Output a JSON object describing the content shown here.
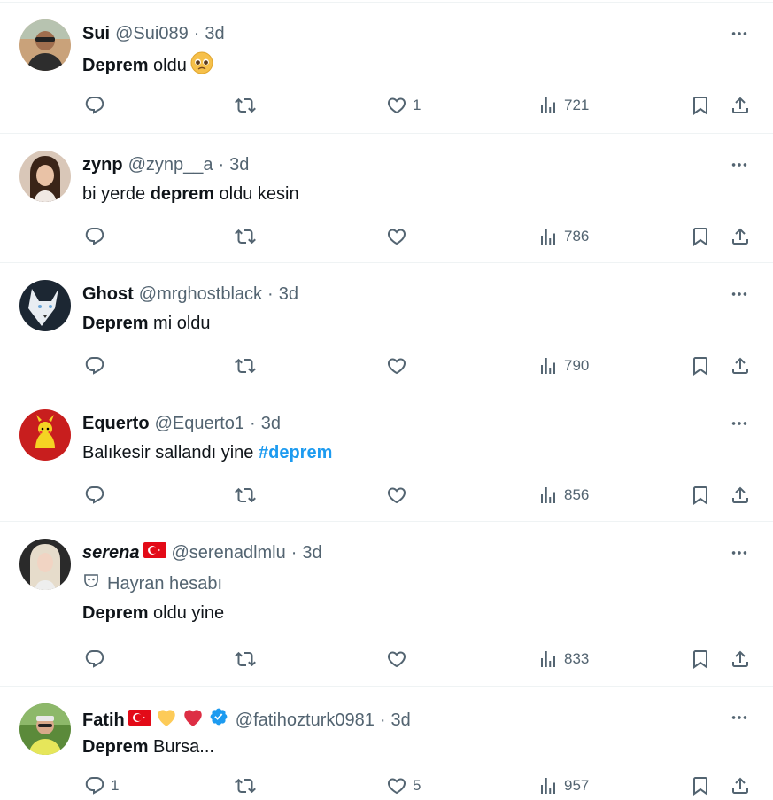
{
  "tweets": [
    {
      "name": "Sui",
      "handle": "@Sui089",
      "dot": "·",
      "time": "3d",
      "text_bold": "Deprem",
      "text_rest": " oldu",
      "emoji": "pleading-face",
      "replies": "",
      "likes": "1",
      "views": "721"
    },
    {
      "name": "zynp",
      "handle": "@zynp__a",
      "dot": "·",
      "time": "3d",
      "text_pre": "bi yerde ",
      "text_bold": "deprem",
      "text_rest": " oldu kesin",
      "replies": "",
      "likes": "",
      "views": "786"
    },
    {
      "name": "Ghost",
      "handle": "@mrghostblack",
      "dot": "·",
      "time": "3d",
      "text_bold": "Deprem",
      "text_rest": " mi oldu",
      "replies": "",
      "likes": "",
      "views": "790"
    },
    {
      "name": "Equerto",
      "handle": "@Equerto1",
      "dot": "·",
      "time": "3d",
      "text_pre": "Balıkesir sallandı yine ",
      "hashtag": "#deprem",
      "replies": "",
      "likes": "",
      "views": "856"
    },
    {
      "name": "serena",
      "handle": "@serenadlmlu",
      "dot": "·",
      "time": "3d",
      "fan_label": "Hayran hesabı",
      "text_bold": "Deprem",
      "text_rest": " oldu yine",
      "replies": "",
      "likes": "",
      "views": "833"
    },
    {
      "name": "Fatih",
      "handle": "@fatihozturk0981",
      "dot": "·",
      "time": "3d",
      "text_bold": "Deprem",
      "text_rest": " Bursa...",
      "replies": "1",
      "likes": "5",
      "views": "957"
    }
  ],
  "icons": {
    "reply": "reply-icon",
    "retweet": "retweet-icon",
    "like": "like-icon",
    "views": "views-icon",
    "bookmark": "bookmark-icon",
    "share": "share-icon",
    "more": "more-icon"
  },
  "colors": {
    "text": "#0f1419",
    "secondary": "#536471",
    "accent": "#1d9bf0",
    "divider": "#eff3f4"
  }
}
